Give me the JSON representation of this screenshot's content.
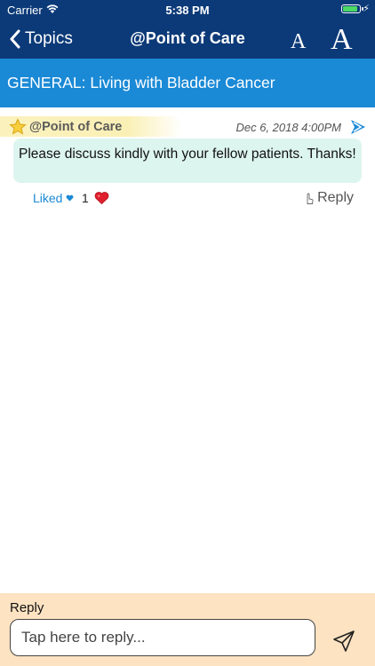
{
  "status": {
    "carrier": "Carrier",
    "time": "5:38 PM",
    "battery_level": 0.9
  },
  "nav": {
    "back_label": "Topics",
    "title": "@Point of Care",
    "font_small_label": "A",
    "font_large_label": "A"
  },
  "topic": {
    "title": "GENERAL: Living with Bladder Cancer"
  },
  "post": {
    "author": "@Point of Care",
    "date": "Dec 6, 2018 4:00PM",
    "message": "Please discuss kindly with your fellow patients. Thanks!",
    "liked_label": "Liked",
    "like_count": "1",
    "reply_label": "Reply"
  },
  "reply_panel": {
    "label": "Reply",
    "placeholder": "Tap here to reply..."
  },
  "colors": {
    "nav_bg": "#0c3a78",
    "topic_bg": "#1a89d6",
    "bubble_bg": "#ddf5ef",
    "reply_bg": "#fde3c2",
    "accent": "#1a89d6"
  }
}
